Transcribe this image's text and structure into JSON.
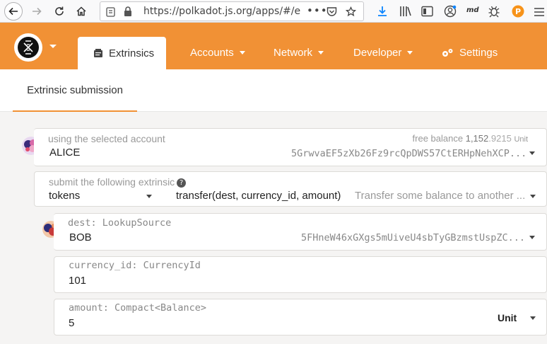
{
  "browser": {
    "url_host": "https://polkadot.js.org",
    "url_path": "/apps/#/e"
  },
  "header": {
    "active_tab": "Extrinsics",
    "nav": [
      "Accounts",
      "Network",
      "Developer",
      "Settings"
    ]
  },
  "subheader": {
    "tab": "Extrinsic submission"
  },
  "account": {
    "label": "using the selected account",
    "balance_label": "free balance",
    "balance_main": "1,152",
    "balance_dec": ".9215",
    "balance_unit": "Unit",
    "name": "ALICE",
    "address": "5GrwvaEF5zXb26Fz9rcQpDWS57CtERHpNehXCP..."
  },
  "extrinsic": {
    "label": "submit the following extrinsic",
    "help": "?",
    "module": "tokens",
    "method": "transfer(dest, currency_id, amount)",
    "description": "Transfer some balance to another ..."
  },
  "params": {
    "dest": {
      "label": "dest: LookupSource",
      "name": "BOB",
      "address": "5FHneW46xGXgs5mUiveU4sbTyGBzmstUspZC..."
    },
    "currency": {
      "label": "currency_id: CurrencyId",
      "value": "101"
    },
    "amount": {
      "label": "amount: Compact<Balance>",
      "value": "5",
      "unit": "Unit"
    }
  },
  "colors": {
    "accent": "#f19135"
  }
}
